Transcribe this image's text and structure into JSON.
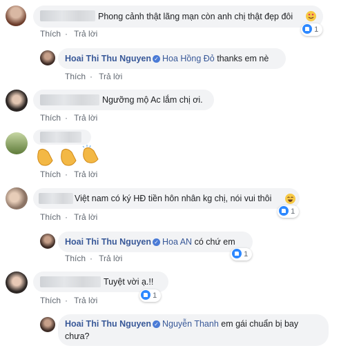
{
  "actions": {
    "like": "Thích",
    "reply": "Trả lời",
    "sep": "·"
  },
  "comments": [
    {
      "text": "Phong cảnh thật lãng mạn còn anh chị thật đẹp đôi",
      "reactions": "1"
    },
    {
      "author": "Hoai Thi Thu Nguyen",
      "tag": "Hoa Hồng Đỏ",
      "text": " thanks em nè"
    },
    {
      "text": "Ngưỡng mộ Ac lắm chị ơi."
    },
    {
      "text": ""
    },
    {
      "text": "Việt nam có ký HĐ tiền hôn nhân kg chị, nói vui thôi",
      "reactions": "1"
    },
    {
      "author": "Hoai Thi Thu Nguyen",
      "tag": "Hoa AN",
      "text": " có chứ em",
      "reactions": "1"
    },
    {
      "text": "Tuyệt vời ạ.!!",
      "reactions": "1"
    },
    {
      "author": "Hoai Thi Thu Nguyen",
      "tag": "Nguyễn Thanh",
      "text_line1": " em gái chuẩn bị bay",
      "text_line2": "chưa?"
    }
  ],
  "colors": {
    "link": "#385898",
    "bubble": "#f2f3f5",
    "like": "#2d88ff"
  },
  "icons": [
    "heart-eyes-emoji-icon",
    "like-icon",
    "clap-emoji-icon",
    "laugh-emoji-icon",
    "verified-icon"
  ]
}
